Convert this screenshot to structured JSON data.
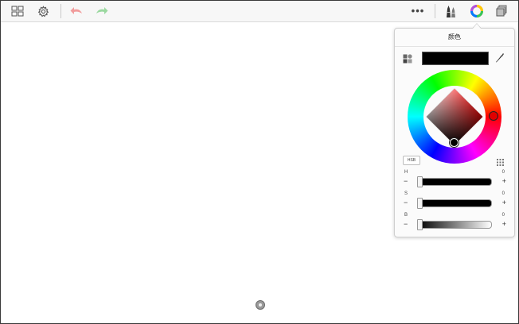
{
  "toolbar": {
    "more_label": "•••"
  },
  "color_panel": {
    "title": "颜色",
    "current_color": "#000000",
    "mode_label": "HSB",
    "sliders": [
      {
        "letter": "H",
        "value": "0",
        "minus": "−",
        "plus": "+",
        "fill": 0.0
      },
      {
        "letter": "S",
        "value": "0",
        "minus": "−",
        "plus": "+",
        "fill": 0.0
      },
      {
        "letter": "B",
        "value": "0",
        "minus": "−",
        "plus": "+",
        "fill": 0.0
      }
    ]
  },
  "icons": {
    "gallery": "grid-icon",
    "settings": "gear-icon",
    "undo": "undo-arrow-icon",
    "redo": "redo-arrow-icon",
    "more": "ellipsis-icon",
    "brushes": "brush-icon",
    "colors": "color-wheel-icon",
    "layers": "layers-icon",
    "swatches": "swatches-icon",
    "eyedropper": "eyedropper-icon",
    "palette_grid": "palette-grid-icon"
  },
  "colors": {
    "undo_color": "#f19c9c",
    "redo_color": "#9bd8a0",
    "accent_hue": "#ff0000"
  }
}
